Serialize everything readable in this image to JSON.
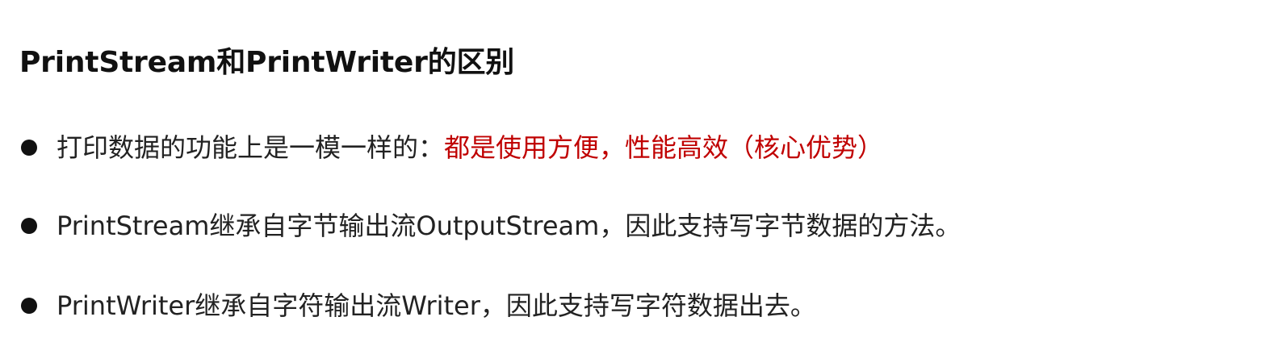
{
  "document": {
    "title": "PrintStream和PrintWriter的区别",
    "bullets": [
      {
        "text": "打印数据的功能上是一模一样的：",
        "accent_text": "都是使用方便，性能高效（核心优势）"
      },
      {
        "text": "PrintStream继承自字节输出流OutputStream，因此支持写字节数据的方法。"
      },
      {
        "text": "PrintWriter继承自字符输出流Writer，因此支持写字符数据出去。"
      }
    ]
  },
  "colors": {
    "text": "#222222",
    "accent": "#c00000",
    "background": "#ffffff"
  }
}
